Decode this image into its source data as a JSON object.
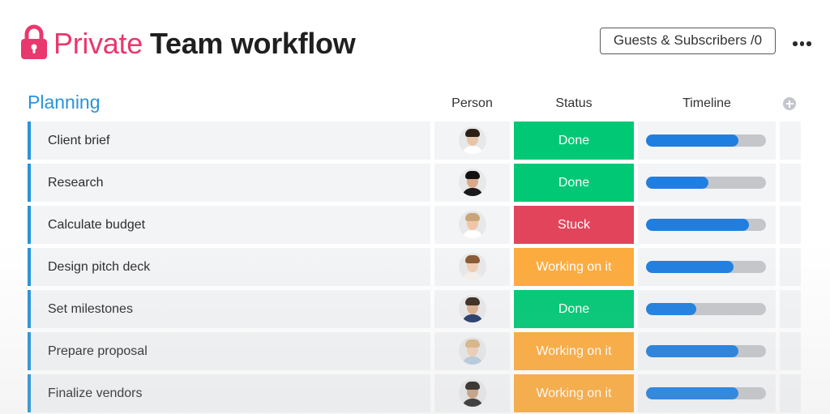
{
  "header": {
    "title_private": "Private",
    "title_name": "Team workflow",
    "guests_label": "Guests & Subscribers /0",
    "lock_color": "#e8386d"
  },
  "board": {
    "group_title": "Planning",
    "columns": {
      "person": "Person",
      "status": "Status",
      "timeline": "Timeline"
    },
    "status_colors": {
      "Done": "#00c875",
      "Stuck": "#e2445c",
      "Working on it": "#fdab3d"
    },
    "timeline_colors": {
      "fill": "#1f7fe0",
      "track": "#c4c6ca"
    },
    "rows": [
      {
        "name": "Client brief",
        "status": "Done",
        "progress": 0.77,
        "avatar": {
          "skin": "#e8c4a8",
          "hair": "#2b2018",
          "shirt": "#ffffff"
        }
      },
      {
        "name": "Research",
        "status": "Done",
        "progress": 0.52,
        "avatar": {
          "skin": "#d9a98a",
          "hair": "#141010",
          "shirt": "#1a1a1a"
        }
      },
      {
        "name": "Calculate budget",
        "status": "Stuck",
        "progress": 0.86,
        "avatar": {
          "skin": "#f0c6a8",
          "hair": "#c9a57a",
          "shirt": "#ffffff"
        }
      },
      {
        "name": "Design pitch deck",
        "status": "Working on it",
        "progress": 0.73,
        "avatar": {
          "skin": "#f1cdb2",
          "hair": "#8a5a36",
          "shirt": "#f5f0ea"
        }
      },
      {
        "name": "Set milestones",
        "status": "Done",
        "progress": 0.42,
        "avatar": {
          "skin": "#dcb08f",
          "hair": "#3a2c20",
          "shirt": "#243c6a"
        }
      },
      {
        "name": "Prepare proposal",
        "status": "Working on it",
        "progress": 0.77,
        "avatar": {
          "skin": "#f0d0b6",
          "hair": "#d8b68a",
          "shirt": "#b8cde0"
        }
      },
      {
        "name": "Finalize vendors",
        "status": "Working on it",
        "progress": 0.77,
        "avatar": {
          "skin": "#caa080",
          "hair": "#2a2420",
          "shirt": "#2c2c2c"
        }
      }
    ]
  }
}
